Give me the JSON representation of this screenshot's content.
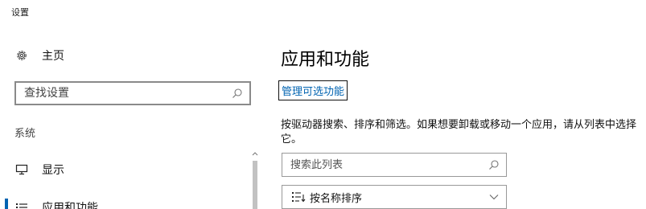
{
  "window": {
    "title": "设置"
  },
  "sidebar": {
    "home": {
      "label": "主页",
      "icon": "gear-icon"
    },
    "search": {
      "placeholder": "查找设置",
      "icon": "search-icon"
    },
    "section_label": "系统",
    "items": [
      {
        "label": "显示",
        "icon": "display-icon"
      },
      {
        "label": "应用和功能",
        "icon": "apps-list-icon",
        "selected": true
      }
    ]
  },
  "main": {
    "title": "应用和功能",
    "manage_link": "管理可选功能",
    "description": "按驱动器搜索、排序和筛选。如果想要卸载或移动一个应用，请从列表中选择它。",
    "list_search": {
      "placeholder": "搜索此列表",
      "icon": "search-icon"
    },
    "sort": {
      "label": "按名称排序",
      "icon": "sort-icon",
      "chevron": "chevron-down-icon"
    }
  },
  "colors": {
    "accent": "#0063b1",
    "link": "#0063b1",
    "text": "#111111",
    "border": "#8a8a8a"
  }
}
